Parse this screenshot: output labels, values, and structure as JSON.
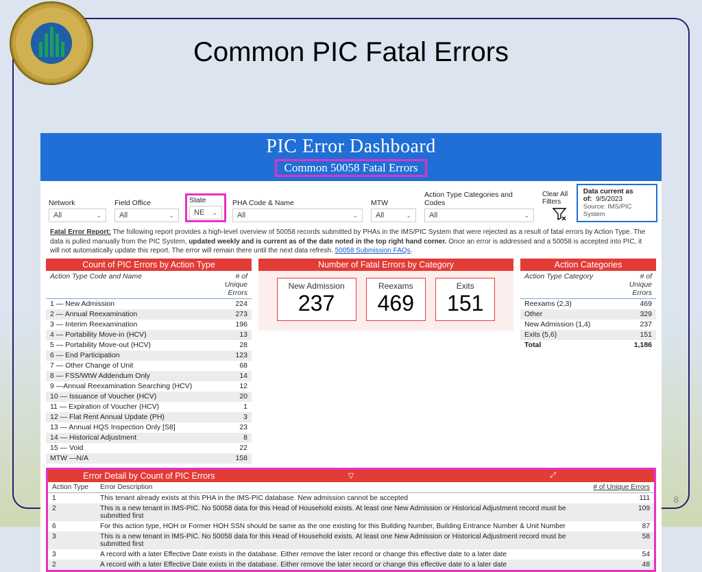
{
  "slide": {
    "title": "Common PIC Fatal Errors",
    "page_number": "8"
  },
  "dashboard": {
    "banner_title": "PIC Error Dashboard",
    "banner_subtitle": "Common 50058 Fatal Errors",
    "filters": {
      "network": {
        "label": "Network",
        "value": "All"
      },
      "field_office": {
        "label": "Field Office",
        "value": "All"
      },
      "state": {
        "label": "State",
        "value": "NE"
      },
      "pha": {
        "label": "PHA Code & Name",
        "value": "All"
      },
      "mtw": {
        "label": "MTW",
        "value": "All"
      },
      "action_type": {
        "label": "Action Type Categories and Codes",
        "value": "All"
      },
      "clear_label": "Clear All Filters"
    },
    "stamp": {
      "label": "Data current as of:",
      "date": "9/5/2023",
      "source": "Source: IMS/PIC System"
    },
    "report_note_label": "Fatal Error Report:",
    "report_note_body": " The following report provides a high-level overview of 50058 records submitted by PHAs in the IMS/PIC System that were rejected as a result of fatal errors by Action Type. The data is pulled manually from the PIC System, ",
    "report_note_bold2": "updated weekly and is current as of the date noted in the top right hand corner.",
    "report_note_tail": " Once an error is addressed and a 50058 is accepted into PIC, it will not automatically update this report.  The error will remain there until the next data refresh. ",
    "faqs_link": "50058 Submission FAQs",
    "left_header": "Count of PIC Errors by Action Type",
    "left_cols": {
      "c1": "Action Type Code and Name",
      "c2": "# of Unique Errors"
    },
    "left_rows": [
      {
        "name": "1 — New Admission",
        "val": "224"
      },
      {
        "name": "2 — Annual Reexamination",
        "val": "273"
      },
      {
        "name": "3 — Interim Reexamination",
        "val": "196"
      },
      {
        "name": "4 — Portability Move-in (HCV)",
        "val": "13"
      },
      {
        "name": "5 — Portability Move-out (HCV)",
        "val": "28"
      },
      {
        "name": "6 — End Participation",
        "val": "123"
      },
      {
        "name": "7 — Other Change of Unit",
        "val": "68"
      },
      {
        "name": "8 — FSS/WtW Addendum Only",
        "val": "14"
      },
      {
        "name": "9 —Annual Reexamination Searching (HCV)",
        "val": "12"
      },
      {
        "name": "10 — Issuance of Voucher (HCV)",
        "val": "20"
      },
      {
        "name": "11 — Expiration of Voucher (HCV)",
        "val": "1"
      },
      {
        "name": "12 — Flat Rent Annual Update (PH)",
        "val": "3"
      },
      {
        "name": "13 — Annual HQS Inspection Only [S8]",
        "val": "23"
      },
      {
        "name": "14 — Historical Adjustment",
        "val": "8"
      },
      {
        "name": "15 — Void",
        "val": "22"
      },
      {
        "name": "MTW —N/A",
        "val": "158"
      }
    ],
    "mid_header": "Number of Fatal Errors by Category",
    "metrics": [
      {
        "label": "New Admission",
        "value": "237"
      },
      {
        "label": "Reexams",
        "value": "469"
      },
      {
        "label": "Exits",
        "value": "151"
      }
    ],
    "right_header": "Action Categories",
    "right_cols": {
      "c1": "Action Type Category",
      "c2": "# of Unique Errors"
    },
    "right_rows": [
      {
        "name": "Reexams (2,3)",
        "val": "469"
      },
      {
        "name": "Other",
        "val": "329"
      },
      {
        "name": "New Admission (1,4)",
        "val": "237"
      },
      {
        "name": "Exits (5,6)",
        "val": "151"
      }
    ],
    "right_total": {
      "name": "Total",
      "val": "1,186"
    },
    "detail_header": "Error Detail by Count of PIC Errors",
    "detail_cols": {
      "a": "Action Type",
      "b": "Error Description",
      "c": "# of Unique Errors"
    },
    "detail_rows": [
      {
        "a": "1",
        "b": "This tenant already exists at this PHA in the IMS-PIC database. New admission cannot be accepted",
        "c": "111"
      },
      {
        "a": "2",
        "b": "This is a new tenant in IMS-PIC. No 50058 data for this Head of Household exists. At least one New Admission or Historical Adjustment record must be submitted first",
        "c": "109"
      },
      {
        "a": "6",
        "b": "For this action type, HOH or Former HOH SSN should be same as the one existing for this Building Number, Building Entrance Number & Unit Number",
        "c": "87"
      },
      {
        "a": "3",
        "b": "This is a new tenant in IMS-PIC. No 50058 data for this Head of Household exists. At least one New Admission or Historical Adjustment record must be submitted first",
        "c": "58"
      },
      {
        "a": "3",
        "b": "A record with a later Effective Date exists in the database. Either remove the later record or change this effective date to a later date",
        "c": "54"
      },
      {
        "a": "2",
        "b": "A record with a later Effective Date exists in the database. Either remove the later record or change this effective date to a later date",
        "c": "48"
      }
    ]
  }
}
